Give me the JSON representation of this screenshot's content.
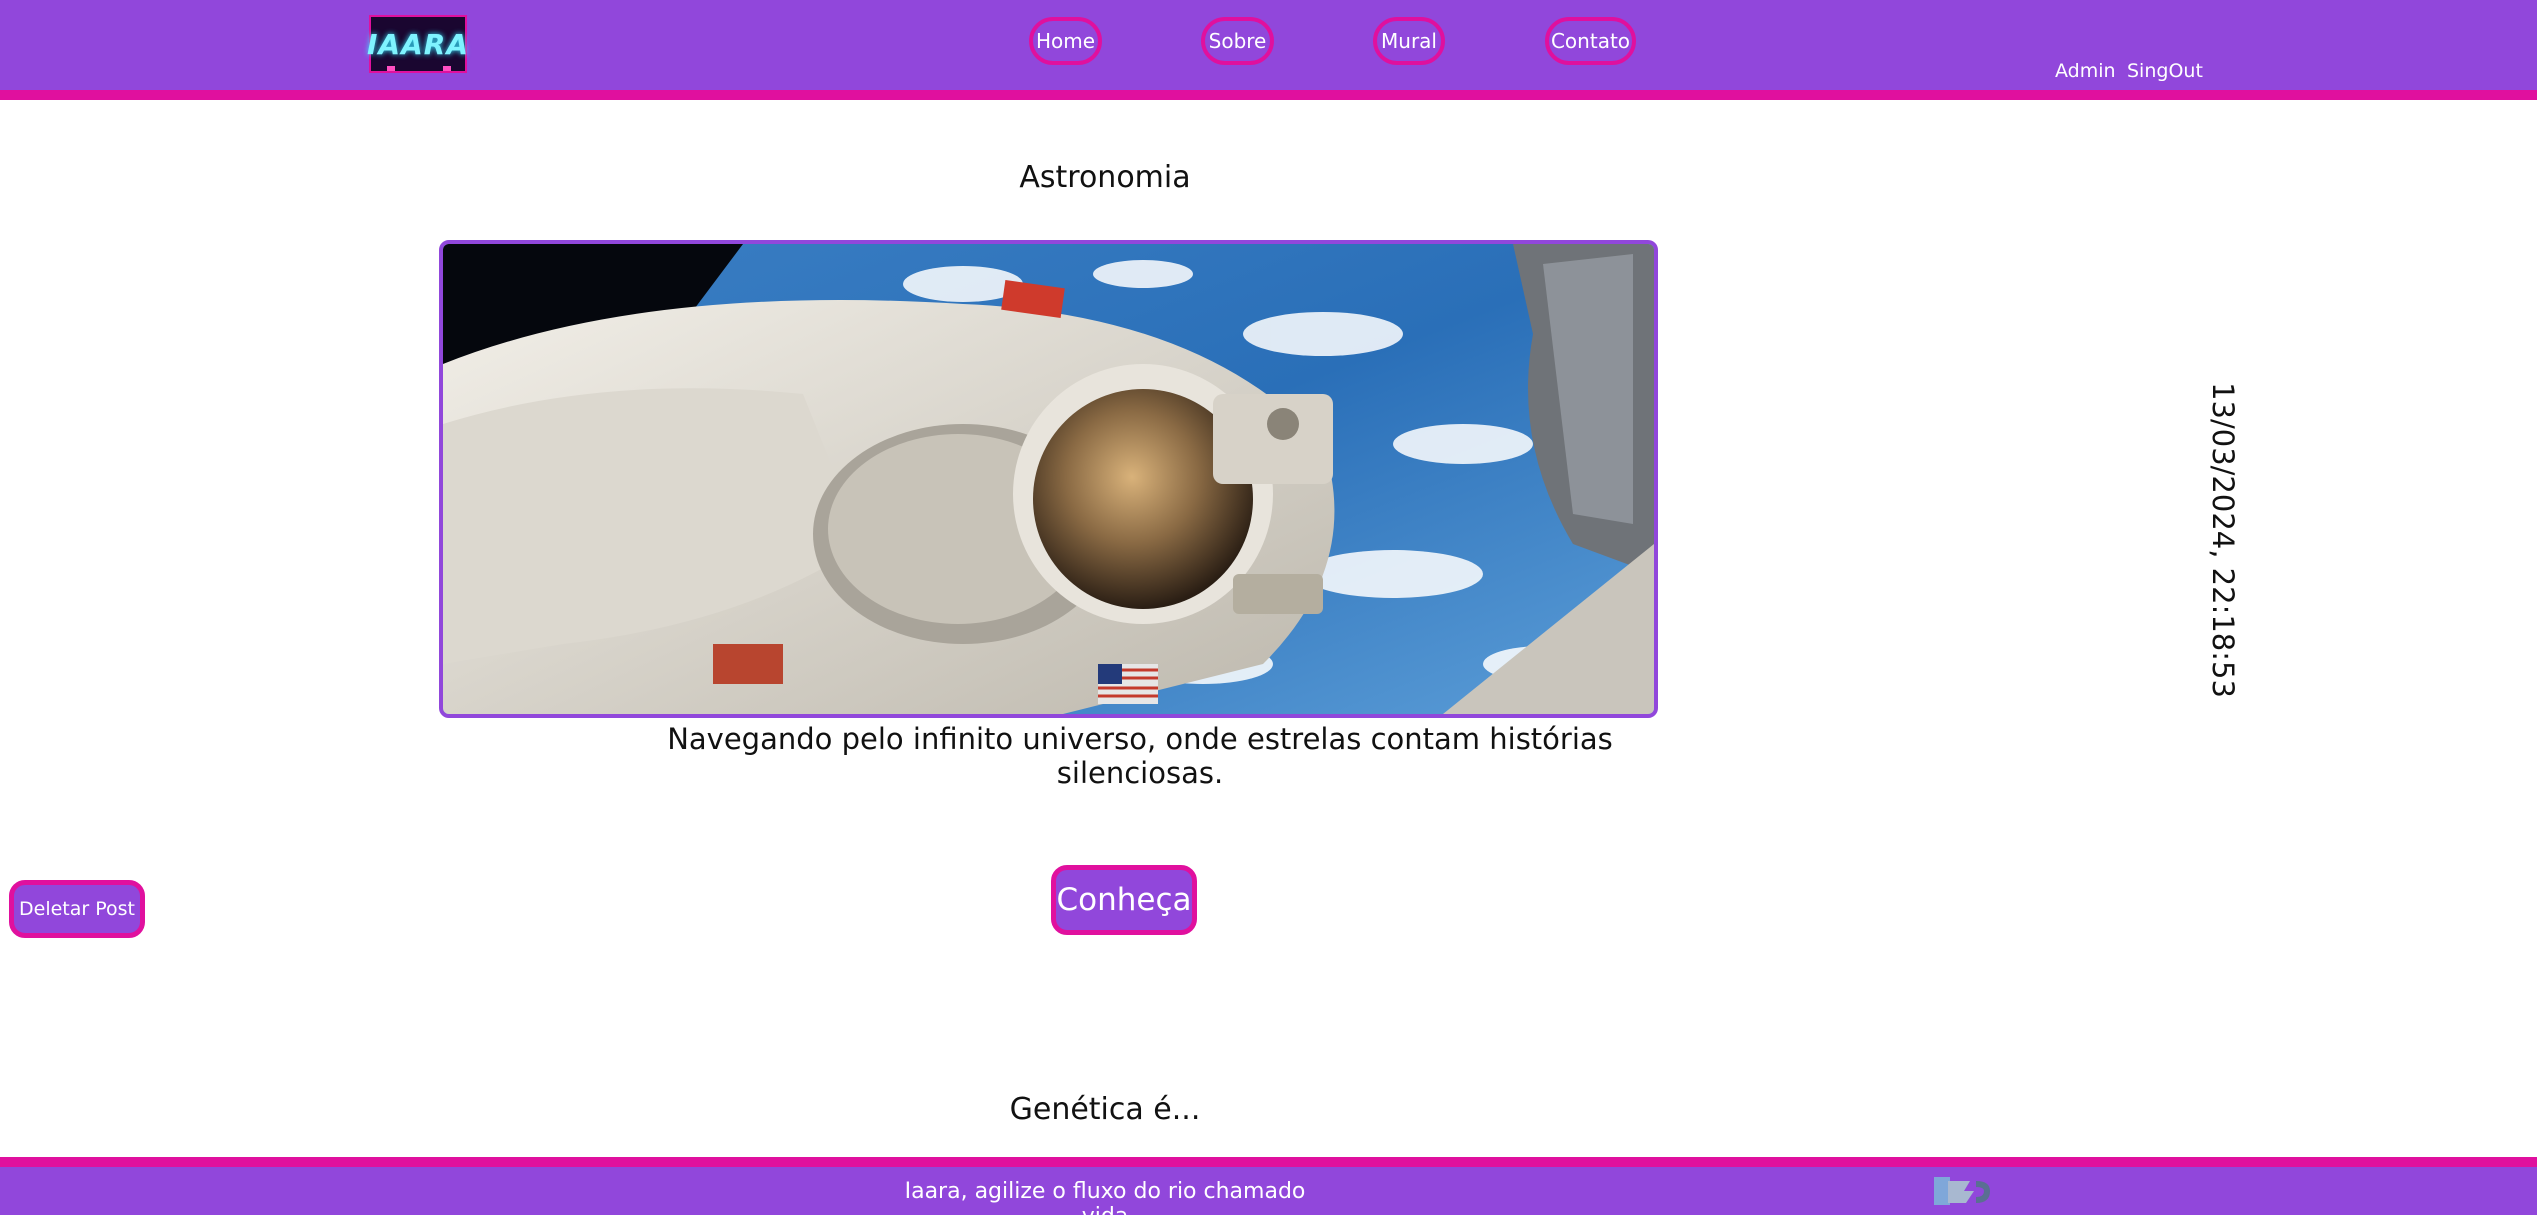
{
  "header": {
    "logo_text": "IAARA",
    "nav": [
      {
        "label": "Home"
      },
      {
        "label": "Sobre"
      },
      {
        "label": "Mural"
      },
      {
        "label": "Contato"
      }
    ],
    "admin_label": "Admin",
    "signout_label": "SingOut"
  },
  "post": {
    "title": "Astronomia",
    "description": "Navegando pelo infinito universo, onde estrelas contam histórias silenciosas.",
    "date": "13/03/2024, 22:18:53",
    "cta_label": "Conheça",
    "delete_label": "Deletar Post"
  },
  "next_post": {
    "title": "Genética é..."
  },
  "footer": {
    "text": "Iaara, agilize o fluxo do rio chamado vida"
  },
  "colors": {
    "brand_purple": "#9147db",
    "brand_pink": "#e0109e"
  }
}
